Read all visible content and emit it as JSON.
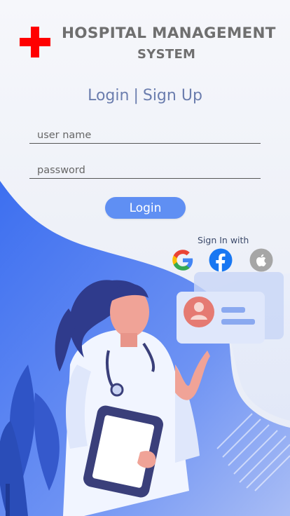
{
  "app": {
    "title_line1": "HOSPITAL MANAGEMENT",
    "title_line2": "SYSTEM"
  },
  "auth_tabs": {
    "login": "Login",
    "separator": "|",
    "signup": "Sign Up"
  },
  "form": {
    "username_placeholder": "user name",
    "password_placeholder": "password",
    "login_label": "Login"
  },
  "social": {
    "heading": "Sign In with",
    "providers": [
      "google-icon",
      "facebook-icon",
      "apple-icon"
    ]
  },
  "colors": {
    "brand_red": "#ff0000",
    "accent_blue": "#5f8ff3",
    "tab_text": "#6b7dae",
    "title_gray": "#6f6f6f",
    "facebook": "#1877f2"
  }
}
